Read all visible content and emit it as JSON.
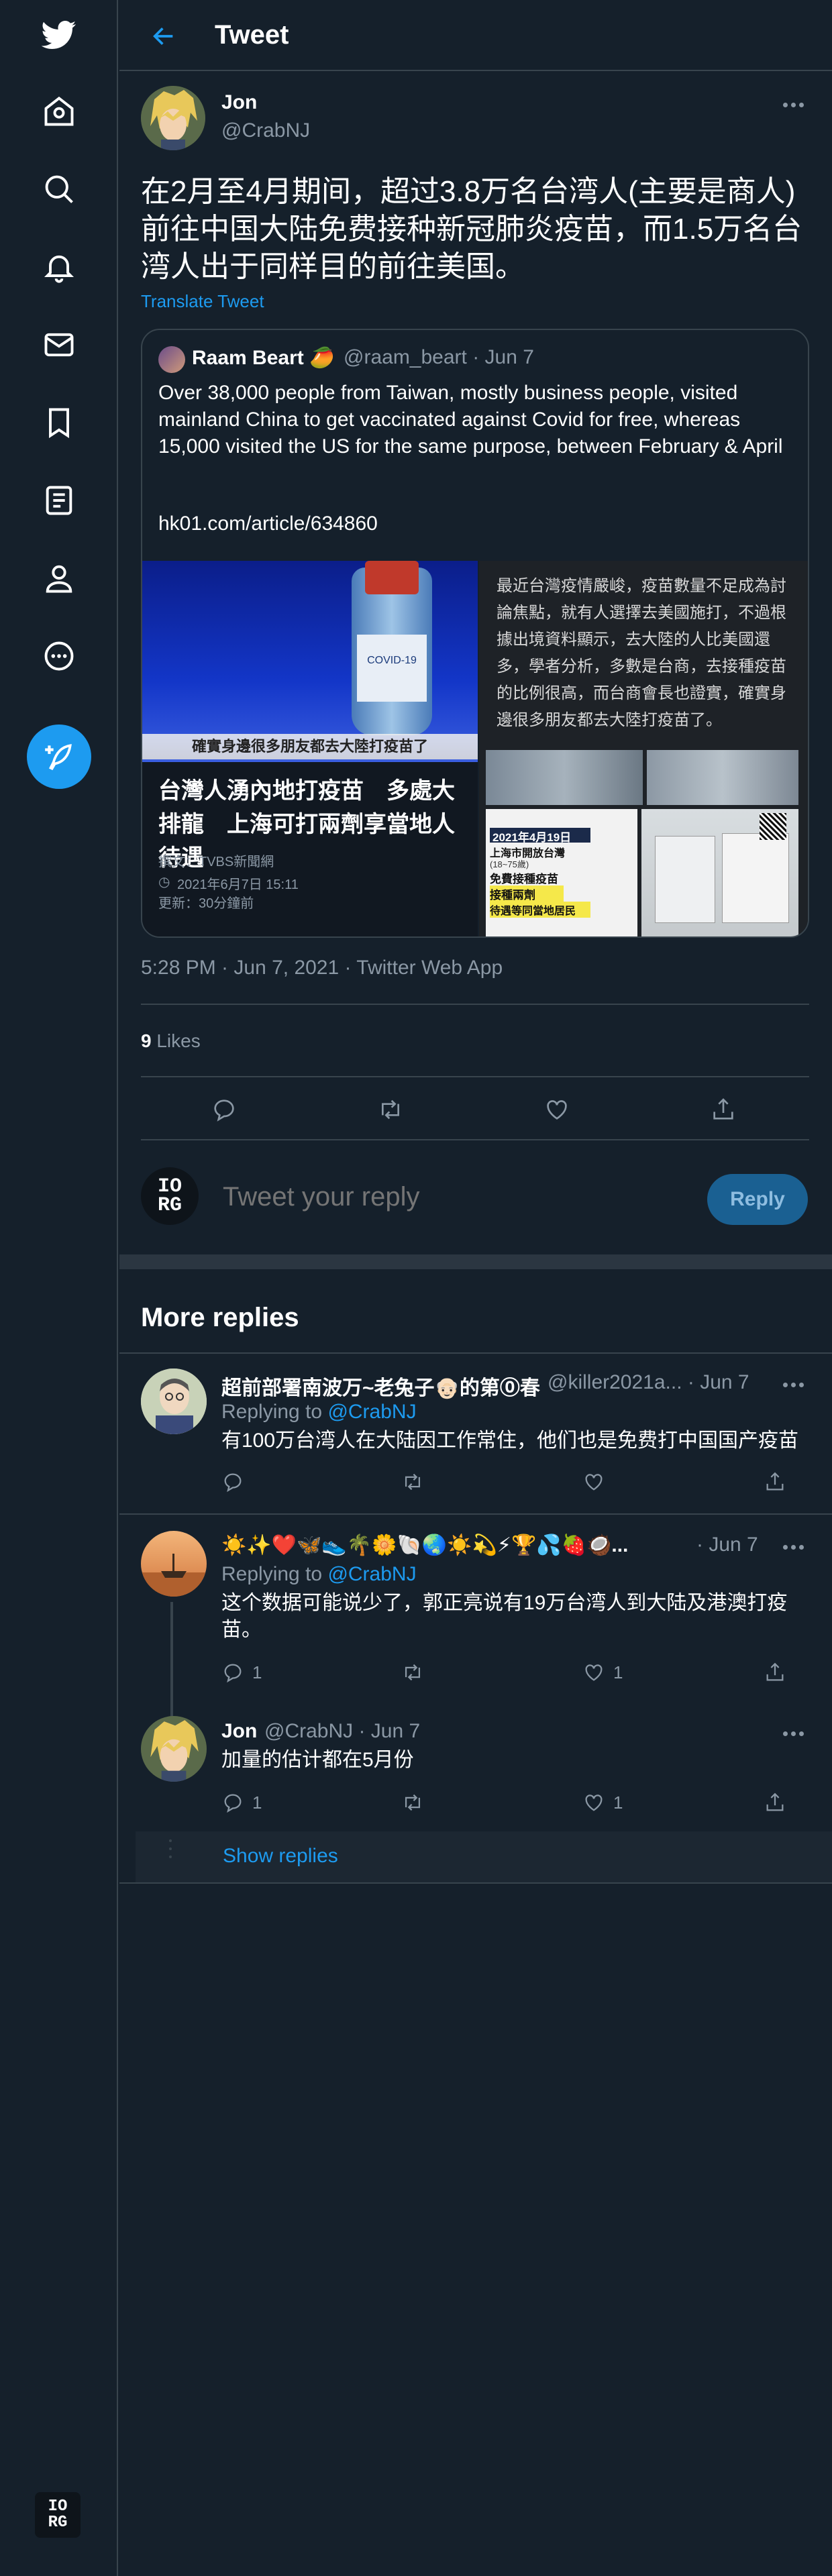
{
  "header": {
    "title": "Tweet"
  },
  "tweet": {
    "author_name": "Jon",
    "author_handle": "@CrabNJ",
    "text": "在2月至4月期间，超过3.8万名台湾人(主要是商人)前往中国大陆免费接种新冠肺炎疫苗，而1.5万名台湾人出于同样目的前往美国。",
    "translate_label": "Translate Tweet",
    "timestamp": "5:28 PM · Jun 7, 2021 · Twitter Web App",
    "likes_count": "9",
    "likes_label": "Likes"
  },
  "quote": {
    "author_name": "Raam Beart 🥭",
    "author_meta": "@raam_beart · Jun 7",
    "text": "Over 38,000 people from Taiwan, mostly business people, visited mainland China to get vaccinated against Covid for free, whereas 15,000 visited the US for the same purpose, between February & April",
    "link": "hk01.com/article/634860",
    "article_left": {
      "caption": "確實身邊很多朋友都去大陸打疫苗了",
      "title": "台灣人湧內地打疫苗　多處大排龍　上海可打兩劑享當地人待遇",
      "source": "撰文：TVBS新聞網",
      "date": "2021年6月7日 15:11",
      "updated": "更新：30分鐘前"
    },
    "article_right": {
      "text": "最近台灣疫情嚴峻，疫苗數量不足成為討論焦點，就有人選擇去美國施打，不過根據出境資料顯示，去大陸的人比美國還多，學者分析，多數是台商，去接種疫苗的比例很高，而台商會長也證實，確實身邊很多朋友都去大陸打疫苗了。",
      "poster_date": "2021年4月19日",
      "poster_line1": "上海市開放台灣",
      "poster_line2": "(18~75歲)",
      "poster_line3": "免費接種疫苗",
      "poster_line4": "接種兩劑",
      "poster_line5": "待遇等同當地居民"
    }
  },
  "reply_box": {
    "avatar_line1": "IO",
    "avatar_line2": "RG",
    "placeholder": "Tweet your reply",
    "button_label": "Reply"
  },
  "more_replies": {
    "title": "More replies",
    "replies": [
      {
        "name": "超前部署南波万~老兔子👴🏻的第⓪春",
        "meta": "@killer2021a... · Jun 7",
        "replying_prefix": "Replying to",
        "replying_to": "@CrabNJ",
        "text": "有100万台湾人在大陆因工作常住，他们也是免费打中国国产疫苗"
      },
      {
        "name": "☀️✨❤️🦋👟🌴🌼🐚🌏☀️💫⚡🏆💦🍓🥥...",
        "meta": "· Jun 7",
        "replying_prefix": "Replying to",
        "replying_to": "@CrabNJ",
        "text": "这个数据可能说少了，郭正亮说有19万台湾人到大陆及港澳打疫苗。",
        "reply_count": "1",
        "like_count": "1"
      },
      {
        "name": "Jon",
        "meta": "@CrabNJ · Jun 7",
        "text": "加量的估计都在5月份",
        "reply_count": "1",
        "like_count": "1"
      }
    ],
    "show_replies": "Show replies"
  },
  "sidebar": {
    "items": [
      "twitter-logo",
      "home",
      "explore",
      "notifications",
      "messages",
      "bookmarks",
      "lists",
      "profile",
      "more"
    ],
    "bottom_avatar_line1": "IO",
    "bottom_avatar_line2": "RG"
  },
  "colors": {
    "background": "#15202b",
    "accent": "#1d9bf0",
    "muted": "#8b98a5",
    "border": "#38444d"
  }
}
